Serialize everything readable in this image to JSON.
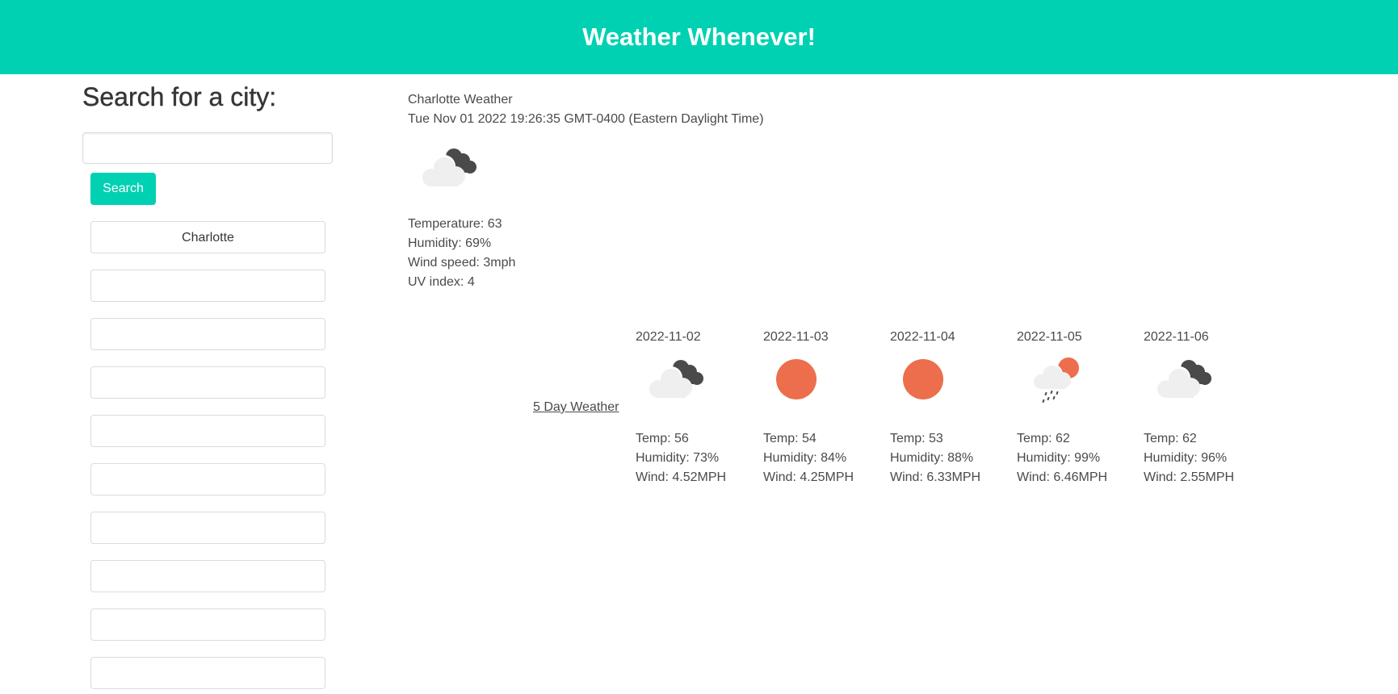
{
  "header": {
    "title": "Weather Whenever!"
  },
  "search": {
    "heading": "Search for a city:",
    "input_value": "",
    "button_label": "Search"
  },
  "history": [
    "Charlotte",
    "",
    "",
    "",
    "",
    "",
    "",
    "",
    "",
    ""
  ],
  "current": {
    "title": "Charlotte Weather",
    "datetime": "Tue Nov 01 2022 19:26:35 GMT-0400 (Eastern Daylight Time)",
    "icon": "cloudy-icon",
    "temperature": "Temperature: 63",
    "humidity": "Humidity: 69%",
    "wind": "Wind speed: 3mph",
    "uv": "UV index: 4"
  },
  "forecast": {
    "link_label": "5 Day Weather",
    "days": [
      {
        "date": "2022-11-02",
        "icon": "cloudy-icon",
        "temp": "Temp: 56",
        "humidity": "Humidity: 73%",
        "wind": "Wind: 4.52MPH"
      },
      {
        "date": "2022-11-03",
        "icon": "sun-icon",
        "temp": "Temp: 54",
        "humidity": "Humidity: 84%",
        "wind": "Wind: 4.25MPH"
      },
      {
        "date": "2022-11-04",
        "icon": "sun-icon",
        "temp": "Temp: 53",
        "humidity": "Humidity: 88%",
        "wind": "Wind: 6.33MPH"
      },
      {
        "date": "2022-11-05",
        "icon": "rain-sun-icon",
        "temp": "Temp: 62",
        "humidity": "Humidity: 99%",
        "wind": "Wind: 6.46MPH"
      },
      {
        "date": "2022-11-06",
        "icon": "cloudy-icon",
        "temp": "Temp: 62",
        "humidity": "Humidity: 96%",
        "wind": "Wind: 2.55MPH"
      }
    ]
  },
  "colors": {
    "accent": "#00d1b2",
    "sun": "#ec6e4c",
    "dark_cloud": "#4a4a4a",
    "light_cloud": "#efefef"
  }
}
